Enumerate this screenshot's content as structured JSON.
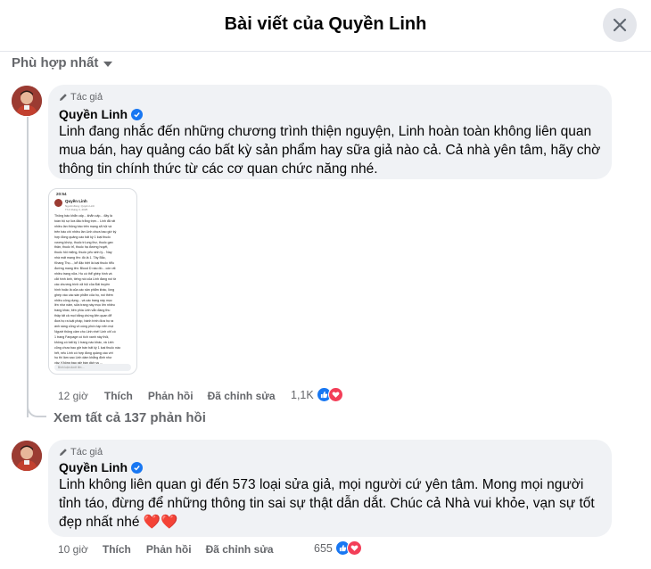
{
  "header": {
    "title": "Bài viết của Quyền Linh"
  },
  "sort": {
    "label": "Phù hợp nhất"
  },
  "comments": [
    {
      "author_tag": "Tác giả",
      "author": "Quyền Linh",
      "lines": [
        "Linh đang nhắc đến những chương trình thiện nguyện, Linh hoàn toàn không liên quan",
        "mua bán, hay quảng cáo bất kỳ sản phẩm hay sữa giả nào cả. Cả nhà yên tâm, hãy chờ",
        "thông tin chính thức từ các cơ quan chức năng nhé."
      ],
      "time": "12 giờ",
      "like": "Thích",
      "reply": "Phản hồi",
      "edited": "Đã chỉnh sửa",
      "reaction_count": "1,1K"
    },
    {
      "author_tag": "Tác giả",
      "author": "Quyền Linh",
      "lines": [
        "Linh không liên quan gì đến 573 loại sửa giả, mọi người cứ yên tâm. Mong mọi người",
        "tỉnh táo, đừng để những thông tin sai sự thật dẫn dắt. Chúc cả Nhà vui khỏe, vạn sự tốt",
        "đẹp nhất nhé ❤️❤️"
      ],
      "time": "10 giờ",
      "like": "Thích",
      "reply": "Phản hồi",
      "edited": "Đã chỉnh sửa",
      "reaction_count": "655"
    }
  ],
  "view_replies": "Xem tất cả 137 phản hồi",
  "attachment": {
    "time": "20:54",
    "name": "Quyền Linh",
    "sub": "Người đóng: Quyền Linh",
    "date": "Th 6 tháng 3, 2025",
    "body": [
      "Thông báo khẩn cấp... khẩn cấp... đây là",
      "toàn bộ sự lừa đảo trắng trợn... Linh đã rất",
      "nhiều lần thông báo trên mạng xã hội và",
      "trên báo chí nhiều lần Linh chưa bao giờ ký",
      "hợp đồng quảng cáo bất kỳ 1 loại thuốc",
      "xương khớp, thuốc trị ung thư, thuốc gan",
      "thận, thuốc trĩ, thuốc hạ đường huyết,",
      "thuốc hôi miệng, thuốc yếu sinh lý... Nay",
      "nhà mất mạng lên: đó là 1. Tây Bắc,",
      "Khang Thọ..., kể đặc biệt là loại thuốc tiểu",
      "đường mang tên: Blood D nào đó... còn rất",
      "nhiều trang nữa. Họ có thể ghép hình và",
      "cắt hình ảnh, tiếng nói của Linh đang nói từ",
      "các chương trình xã hội của Đài truyền",
      "hình hoặc là của các sản phẩm khác, lồng",
      "ghép vào các sản phẩm của họ, nói thêm",
      "nhiều công dụng... và các trang này mọc",
      "lên như nấm, sửa trang này mọc lên nhiều",
      "trang khác, bên phía Linh vẫn đang thu",
      "thập tất cả mọi bằng chứng liên quan để",
      "đưa họ ra luật pháp, hành trình đưa họ ra",
      "ánh sáng cũng vô cùng phức tạp nên mọi",
      "Người thông cảm cho Linh nhé! Linh chỉ có",
      "1 trang Fanpage có tích xanh này thôi,",
      "không có bất kỳ 1 trang nào khác, và Linh",
      "cũng chưa bao giờ bán bất kỳ 1 loại thuốc nào",
      "hết, nếu Linh có hợp đồng quảng cáo với",
      "họ thì làm sao Linh dám khẳng định như",
      "vậy. Không bao giờ bán dịch vụ ..."
    ],
    "footer": "Bình luận dưới tên ..."
  },
  "icons": {
    "close": "close-icon",
    "pencil": "pencil-icon",
    "verified": "verified-badge-icon",
    "like": "like-icon",
    "love": "heart-icon",
    "caret": "caret-down-icon"
  },
  "colors": {
    "accent": "#1877f2",
    "bubble": "#f0f2f5",
    "secondary_text": "#65676b",
    "love": "#f33e58"
  }
}
